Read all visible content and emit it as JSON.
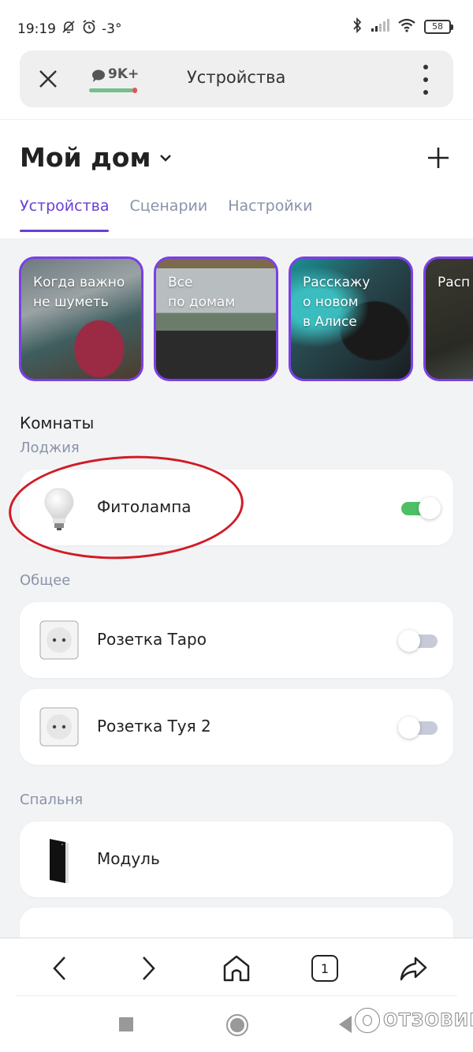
{
  "status_bar": {
    "time": "19:19",
    "temperature": "-3°",
    "battery": "58",
    "icons": [
      "muted-bell-icon",
      "alarm-icon",
      "bluetooth-icon",
      "signal-icon",
      "wifi-icon",
      "battery-icon"
    ]
  },
  "browser_top": {
    "notification_count": "9K+",
    "title": "Устройства"
  },
  "header": {
    "home_title": "Мой дом",
    "tabs": [
      {
        "label": "Устройства",
        "active": true
      },
      {
        "label": "Сценарии",
        "active": false
      },
      {
        "label": "Настройки",
        "active": false
      }
    ]
  },
  "stories": [
    {
      "text": "Когда важно\nне шуметь"
    },
    {
      "text": "Все\nпо домам"
    },
    {
      "text": "Расскажу\nо новом\nв Алисе"
    },
    {
      "text": "Расп"
    }
  ],
  "rooms": {
    "title": "Комнаты",
    "groups": [
      {
        "name": "Лоджия",
        "devices": [
          {
            "name": "Фитолампа",
            "icon": "lightbulb-icon",
            "toggle": "on"
          }
        ]
      },
      {
        "name": "Общее",
        "devices": [
          {
            "name": "Розетка Таро",
            "icon": "socket-icon",
            "toggle": "off"
          },
          {
            "name": "Розетка Туя 2",
            "icon": "socket-icon",
            "toggle": "off"
          }
        ]
      },
      {
        "name": "Спальня",
        "devices": [
          {
            "name": "Модуль",
            "icon": "module-icon"
          },
          {
            "name": "",
            "icon": "alice-speaker-icon"
          }
        ]
      }
    ]
  },
  "browser_bottom": {
    "tabs_count": "1"
  },
  "watermark": "ОТЗОВИК",
  "colors": {
    "accent": "#6b3fd4",
    "toggle_on": "#4fbf65",
    "toggle_off": "#c7cad8",
    "annotation_red": "#d11b25"
  }
}
